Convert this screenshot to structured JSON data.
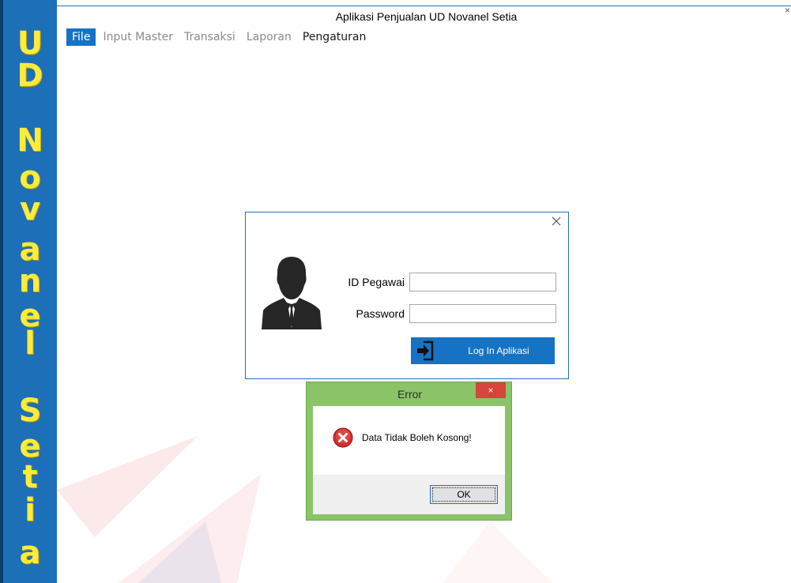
{
  "window": {
    "title": "Aplikasi Penjualan UD Novanel Setia",
    "close_glyph": "×"
  },
  "sidebar": {
    "letters": [
      "U",
      "D",
      "N",
      "o",
      "v",
      "a",
      "n",
      "e",
      "l",
      "S",
      "e",
      "t",
      "i",
      "a"
    ],
    "color": "#1d6fb8",
    "letter_color": "#ffeb3b"
  },
  "menu": {
    "items": [
      {
        "label": "File"
      },
      {
        "label": "Input Master"
      },
      {
        "label": "Transaksi"
      },
      {
        "label": "Laporan"
      },
      {
        "label": "Pengaturan"
      }
    ],
    "active_color": "#1673c4"
  },
  "login": {
    "close_icon": "close-icon",
    "id_label": "ID Pegawai",
    "id_value": "",
    "password_label": "Password",
    "password_value": "",
    "button_label": "Log In Aplikasi",
    "button_color": "#1673c4"
  },
  "error": {
    "title": "Error",
    "close_glyph": "×",
    "message": "Data Tidak Boleh Kosong!",
    "ok_label": "OK",
    "frame_color": "#8ac368"
  }
}
